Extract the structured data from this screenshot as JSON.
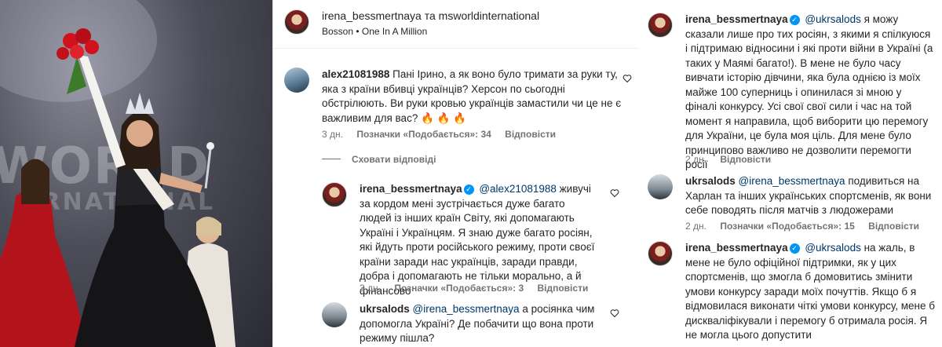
{
  "post_header": {
    "names_text": "irena_bessmertnaya та msworldinternational",
    "author": "irena_bessmertnaya",
    "joiner": "та",
    "coauthor": "msworldinternational",
    "song": "Bosson • One In A Million"
  },
  "photo": {
    "wordmark": "WORLD",
    "wordmark2": "ERNATIONAL"
  },
  "comments": [
    {
      "user": "alex21081988",
      "text": "Пані Ірино, а як воно було тримати за руки ту, яка з країни вбивці українців? Херсон по сьогодні обстрілюють. Ви руки кровью українців замастили чи це не є важливим для вас? 🔥 🔥 🔥",
      "time": "3 дн.",
      "likes": "Позначки «Подобається»: 34",
      "reply": "Відповісти"
    },
    {
      "hide_replies": "Сховати відповіді"
    },
    {
      "user": "irena_bessmertnaya",
      "mention": "@alex21081988",
      "text": "живучі за кордом мені зустрічається дуже багато людей із інших країн Світу, які допомагають Україні і Українцям. Я знаю дуже багато росіян, які йдуть проти російського режиму, проти своєї країни заради нас українців, заради правди, добра і допомагають не тільки морально, а й фінансово",
      "time": "3 дн.",
      "likes": "Позначки «Подобається»: 3",
      "reply": "Відповісти"
    },
    {
      "user": "ukrsalods",
      "mention": "@irena_bessmertnaya",
      "text": "а росіянка чим допомогла Україні? Де побачити що вона проти режиму пішла?"
    },
    {
      "user": "irena_bessmertnaya",
      "mention": "@ukrsalods",
      "text": "я можу сказали лише про тих росіян, з якими я спілкуюся і підтримаю відносини і які проти війни в Україні (а таких у Маямі багато!). В мене не було часу вивчати історію дівчини, яка була однією із моїх майже 100 суперниць і опинилася зі мною у фіналі конкурсу. Усі свої свої сили і час на той момент я направила, щоб виборити цю перемогу для України, це була моя ціль. Для мене було принципово важливо не дозволити перемогти росії",
      "time": "2 дн.",
      "reply": "Відповісти"
    },
    {
      "user": "ukrsalods",
      "mention": "@irena_bessmertnaya",
      "text": "подивиться на Харлан та інших українських спортсменів, як вони себе поводять після матчів з людожерами",
      "time": "2 дн.",
      "likes": "Позначки «Подобається»: 15",
      "reply": "Відповісти"
    },
    {
      "user": "irena_bessmertnaya",
      "mention": "@ukrsalods",
      "text": "на жаль, в мене не було офіційної підтримки, як у цих спортсменів, що змогла б домовитись змінити умови конкурсу заради моїх почуттів. Якщо б я відмовилася виконати чіткі умови конкурсу, мене б дискваліфікували і перемогу б отримала росія. Я не могла цього допустити"
    }
  ],
  "colors": {
    "mention": "#00376b",
    "verified": "#0095f6",
    "meta": "#737373",
    "fire": "#f07a1a"
  },
  "icons": {
    "heart": "heart-icon",
    "verified": "verified-badge-icon"
  }
}
